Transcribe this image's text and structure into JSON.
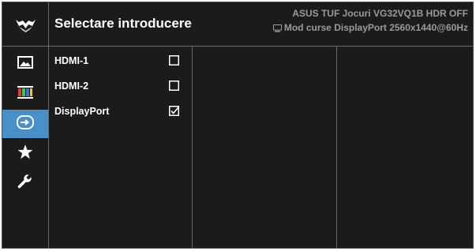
{
  "header": {
    "title": "Selectare introducere",
    "model_info": "ASUS TUF Jocuri VG32VQ1B HDR OFF",
    "mode_info": "Mod curse  DisplayPort 2560x1440@60Hz",
    "mode_icon": "monitor-icon",
    "logo_icon": "tuf-gaming-logo-icon"
  },
  "sidebar": {
    "items": [
      {
        "icon": "image-icon",
        "active": false
      },
      {
        "icon": "color-bars-icon",
        "active": false
      },
      {
        "icon": "input-select-icon",
        "active": true
      },
      {
        "icon": "star-icon",
        "active": false
      },
      {
        "icon": "wrench-icon",
        "active": false
      }
    ]
  },
  "options": [
    {
      "label": "HDMI-1",
      "checked": false
    },
    {
      "label": "HDMI-2",
      "checked": false
    },
    {
      "label": "DisplayPort",
      "checked": true
    }
  ],
  "colors": {
    "background": "#1b1b1b",
    "accent": "#4a90c8",
    "divider": "#6a6a6a",
    "info_text": "#9a9a9a"
  }
}
